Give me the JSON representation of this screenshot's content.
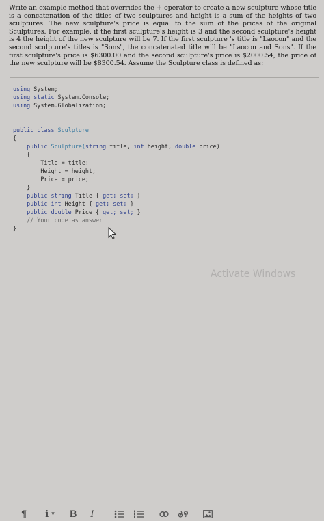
{
  "question": {
    "text": "Write an example method that overrides the + operator to create a new sculpture whose title is a concatenation of the titles of two sculptures and height is a sum of the heights of two sculptures. The new sculpture's price is equal to the sum of the prices of the original Sculptures. For example, if the first sculpture's height is 3 and the second sculpture's height is 4 the height of the new sculpture will be 7. If the first sculpture 's title is \"Laocon\" and the second sculpture's titles is \"Sons\", the concatenated title will be \"Laocon and Sons\". If the first sculpture's price is $6300.00 and the second sculpture's price is $2000.54, the price of the new sculpture will be $8300.54. Assume the Sculpture class is defined as:"
  },
  "code": {
    "l1a": "using",
    "l1b": " System;",
    "l2a": "using static",
    "l2b": " System.Console;",
    "l3a": "using",
    "l3b": " System.Globalization;",
    "l4a": "public class",
    "l4b": " Sculpture",
    "l5": "{",
    "l6a": "public",
    "l6b": " Sculpture(",
    "l6c": "string",
    "l6d": " title, ",
    "l6e": "int",
    "l6f": " height, ",
    "l6g": "double",
    "l6h": " price)",
    "l7": "{",
    "l8": "Title = title;",
    "l9": "Height = height;",
    "l10": "Price = price;",
    "l11": "}",
    "l12a": "public string",
    "l12b": " Title { ",
    "l12c": "get; set;",
    "l12d": " }",
    "l13a": "public int",
    "l13b": " Height { ",
    "l13c": "get; set;",
    "l13d": " }",
    "l14a": "public double",
    "l14b": " Price { ",
    "l14c": "get; set;",
    "l14d": " }",
    "l15": "// Your code as answer",
    "l16": "}"
  },
  "toolbar": {
    "paragraph_label": "¶",
    "info_label": "i",
    "dropdown_caret": "▾",
    "bold_label": "B",
    "italic_label": "I"
  },
  "watermark": "Activate Windows",
  "colors": {
    "background": "#cfcdcb",
    "keyword": "#2d3f8c",
    "type": "#3a7aa0",
    "text": "#1a1a1a"
  }
}
